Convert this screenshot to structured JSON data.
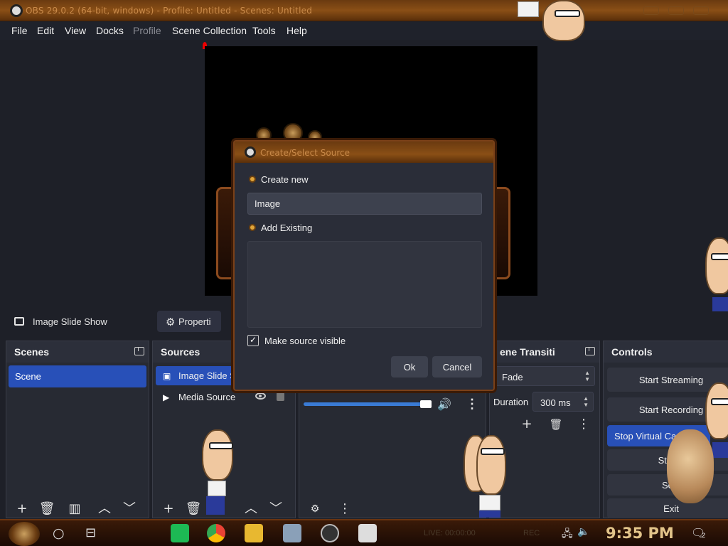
{
  "window": {
    "title": "OBS 29.0.2 (64-bit, windows) - Profile: Untitled - Scenes: Untitled"
  },
  "menu": [
    "File",
    "Edit",
    "View",
    "Docks",
    "Profile",
    "Scene Collection",
    "Tools",
    "Help"
  ],
  "source_bar": {
    "selected_source": "Image Slide Show",
    "properties_label": "Properti"
  },
  "docks": {
    "scenes": {
      "title": "Scenes",
      "items": [
        "Scene"
      ]
    },
    "sources": {
      "title": "Sources",
      "items": [
        {
          "label": "Image Slide S",
          "icon": "slideshow-icon"
        },
        {
          "label": "Media Source",
          "icon": "play-icon"
        }
      ]
    },
    "transitions": {
      "title": "ene Transiti",
      "type": "Fade",
      "duration_label": "Duration",
      "duration_value": "300 ms"
    },
    "controls": {
      "title": "Controls",
      "buttons": [
        "Start Streaming",
        "Start Recording",
        "Stop Virtual Ca",
        "Studio",
        "Setti",
        "Exit"
      ]
    }
  },
  "dialog": {
    "title": "Create/Select Source",
    "create_new_label": "Create new",
    "name_value": "Image",
    "add_existing_label": "Add Existing",
    "make_visible_label": "Make source visible",
    "ok_label": "Ok",
    "cancel_label": "Cancel"
  },
  "taskbar": {
    "clock": "9:35 PM",
    "live_status": "LIVE: 00:00:00",
    "rec_status": "REC",
    "notification_count": "2"
  },
  "colors": {
    "accent": "#2850b8",
    "title_bar": "#8a4f16",
    "clock": "#e2c48a"
  }
}
